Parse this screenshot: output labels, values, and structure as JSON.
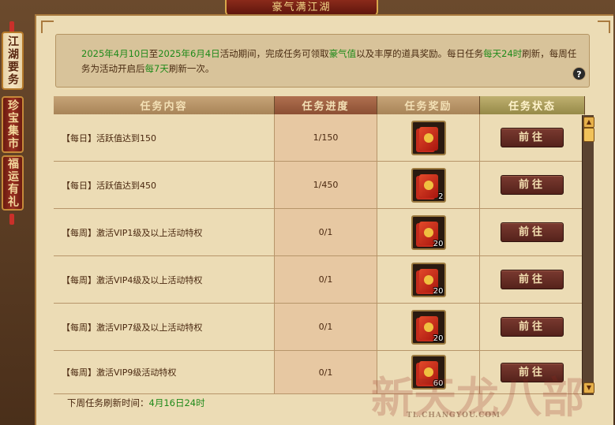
{
  "window": {
    "title": "豪气满江湖"
  },
  "side_tabs": [
    {
      "label": "江湖要务",
      "active": true
    },
    {
      "label": "珍宝集市",
      "active": false
    },
    {
      "label": "福运有礼",
      "active": false
    }
  ],
  "description": {
    "date_start": "2025年4月10日",
    "to": "至",
    "date_end": "2025年6月4日",
    "text1": "活动期间，完成任务可领取",
    "currency": "豪气值",
    "text2": "以及丰厚的道具奖励。每日任务",
    "daily_time": "每天24时",
    "text3": "刷新，每周任务为活动开启后",
    "weekly_days": "每7天",
    "text4": "刷新一次。"
  },
  "help_icon": "?",
  "table": {
    "headers": [
      "任务内容",
      "任务进度",
      "任务奖励",
      "任务状态"
    ],
    "rows": [
      {
        "task": "【每日】活跃值达到150",
        "progress": "1/150",
        "reward_qty": "",
        "status": "前往"
      },
      {
        "task": "【每日】活跃值达到450",
        "progress": "1/450",
        "reward_qty": "2",
        "status": "前往"
      },
      {
        "task": "【每周】激活VIP1级及以上活动特权",
        "progress": "0/1",
        "reward_qty": "20",
        "status": "前往"
      },
      {
        "task": "【每周】激活VIP4级及以上活动特权",
        "progress": "0/1",
        "reward_qty": "20",
        "status": "前往"
      },
      {
        "task": "【每周】激活VIP7级及以上活动特权",
        "progress": "0/1",
        "reward_qty": "20",
        "status": "前往"
      },
      {
        "task": "【每周】激活VIP9级活动特权",
        "progress": "0/1",
        "reward_qty": "60",
        "status": "前往"
      }
    ]
  },
  "footer": {
    "label": "下周任务刷新时间：",
    "value": "4月16日24时"
  },
  "watermark": {
    "main": "新天龙八部",
    "sub": "TL.CHANGYOU.COM"
  },
  "colors": {
    "highlight": "#1f8a1a",
    "button": "#6a2e25",
    "panel": "#ecdcb5"
  }
}
